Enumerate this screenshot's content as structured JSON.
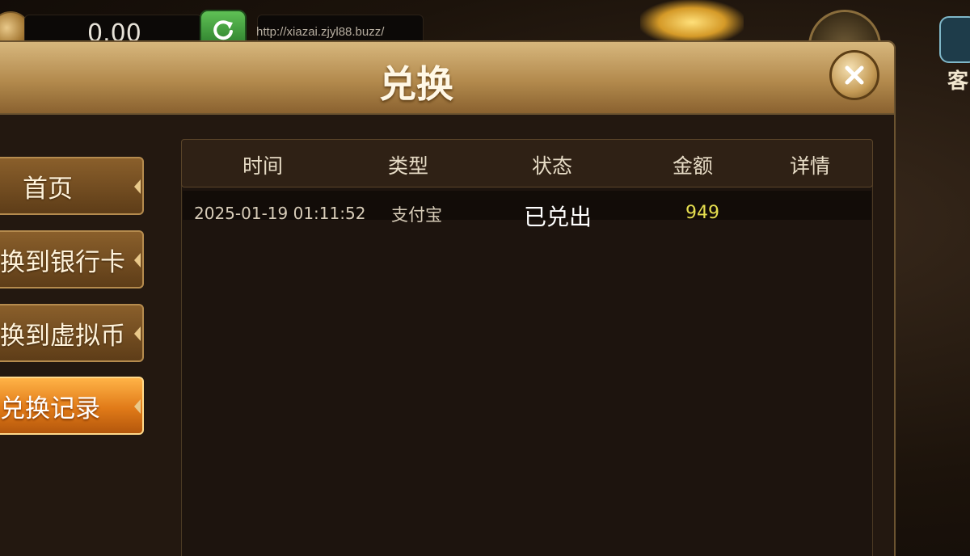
{
  "topbar": {
    "balance": "0.00",
    "url": "http://xiazai.zjyl88.buzz/",
    "service_label": "客"
  },
  "dialog": {
    "title": "兑换"
  },
  "menu": {
    "items": [
      {
        "label": "首页",
        "active": false
      },
      {
        "label": "换到银行卡",
        "active": false
      },
      {
        "label": "换到虚拟币",
        "active": false
      },
      {
        "label": "兑换记录",
        "active": true
      }
    ]
  },
  "table": {
    "headers": [
      "时间",
      "类型",
      "状态",
      "金额",
      "详情"
    ],
    "rows": [
      {
        "time": "2025-01-19 01:11:52",
        "type": "支付宝",
        "status": "已兑出",
        "amount": "949",
        "detail": ""
      }
    ]
  },
  "colors": {
    "header_gold": "#c9a364",
    "active_orange": "#e07a18",
    "amount_yellow": "#e5de4f"
  },
  "icons": {
    "refresh": "refresh-icon",
    "close": "close-icon",
    "coin": "coin-icon",
    "service": "customer-service-icon"
  }
}
